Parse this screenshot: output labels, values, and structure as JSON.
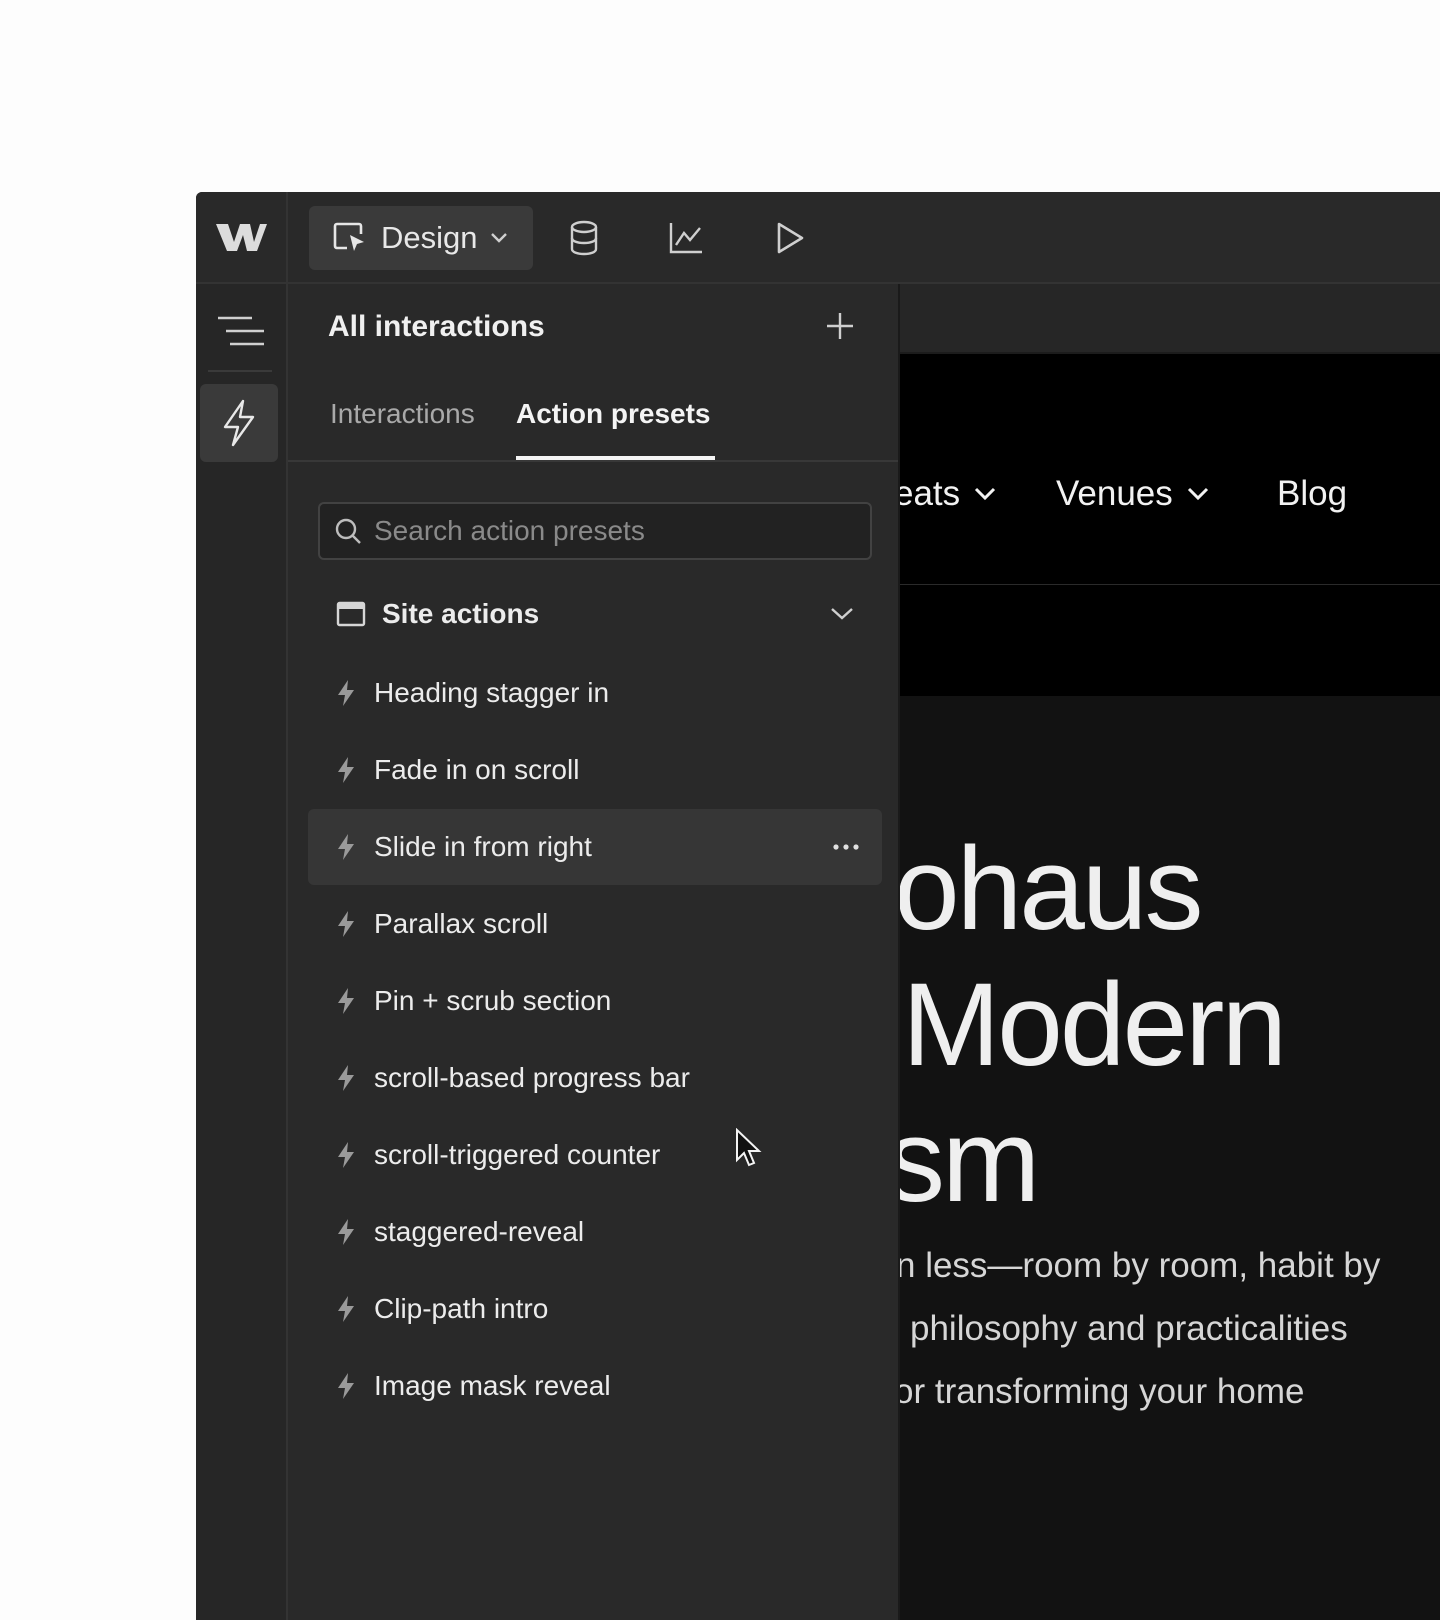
{
  "topbar": {
    "logo": "webflow-logo",
    "mode_label": "Design",
    "icons": [
      "cms-database-icon",
      "analytics-chart-icon",
      "preview-play-icon"
    ]
  },
  "rail": {
    "icons": [
      "navigator-menu-icon",
      "interactions-bolt-icon"
    ]
  },
  "panel": {
    "title": "All interactions",
    "tabs": [
      {
        "label": "Interactions",
        "active": false
      },
      {
        "label": "Action presets",
        "active": true
      }
    ],
    "search_placeholder": "Search action presets",
    "group": {
      "label": "Site actions",
      "expanded": true,
      "items": [
        {
          "label": "Heading stagger in"
        },
        {
          "label": "Fade in on scroll"
        },
        {
          "label": "Slide in from right",
          "hovered": true
        },
        {
          "label": "Parallax scroll"
        },
        {
          "label": "Pin + scrub section"
        },
        {
          "label": "scroll-based progress bar"
        },
        {
          "label": "scroll-triggered counter"
        },
        {
          "label": "staggered-reveal"
        },
        {
          "label": "Clip-path intro"
        },
        {
          "label": "Image mask reveal"
        }
      ]
    }
  },
  "canvas": {
    "nav": [
      "eats",
      "Venues",
      "Blog"
    ],
    "hero_lines": [
      "ohaus",
      "Modern",
      "sm"
    ],
    "sub_lines": [
      "n less—room by room, habit by",
      "philosophy and practicalities",
      "or transforming your home"
    ]
  }
}
